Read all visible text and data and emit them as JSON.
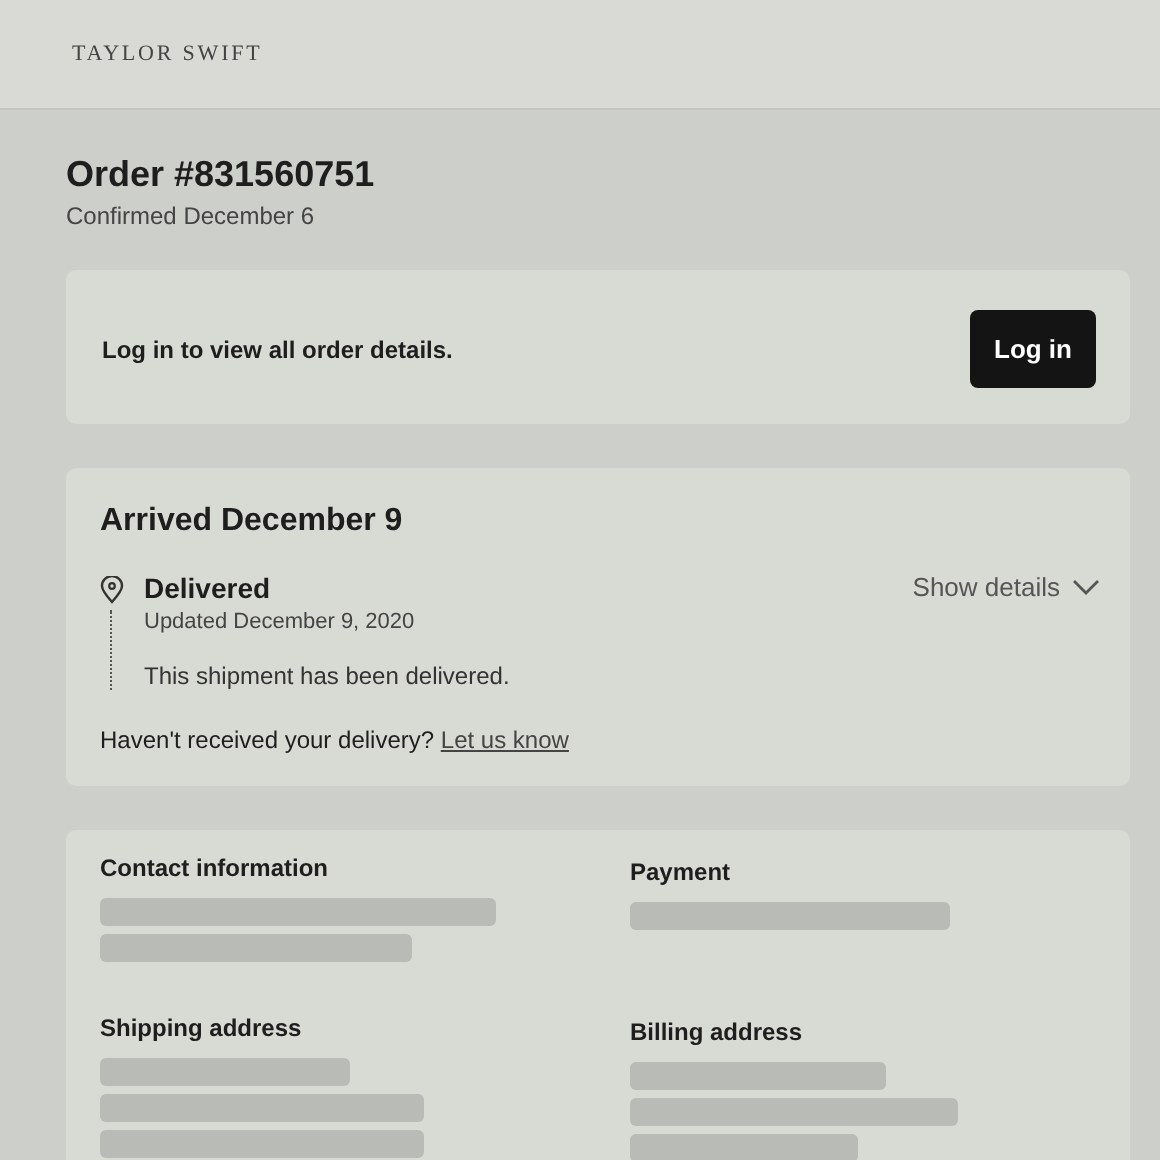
{
  "header": {
    "brand": "TAYLOR SWIFT"
  },
  "order": {
    "title": "Order #831560751",
    "subtitle": "Confirmed December 6"
  },
  "login_card": {
    "message": "Log in to view all order details.",
    "button": "Log in"
  },
  "shipment": {
    "title": "Arrived December 9",
    "status": "Delivered",
    "updated": "Updated December 9, 2020",
    "toggle": "Show details",
    "expanded": false,
    "note": "This shipment has been delivered.",
    "question": "Haven't received your delivery?",
    "link": "Let us know"
  },
  "info_sections": [
    {
      "heading": "Contact information"
    },
    {
      "heading": "Payment"
    },
    {
      "heading": "Shipping address"
    },
    {
      "heading": "Billing address"
    }
  ]
}
